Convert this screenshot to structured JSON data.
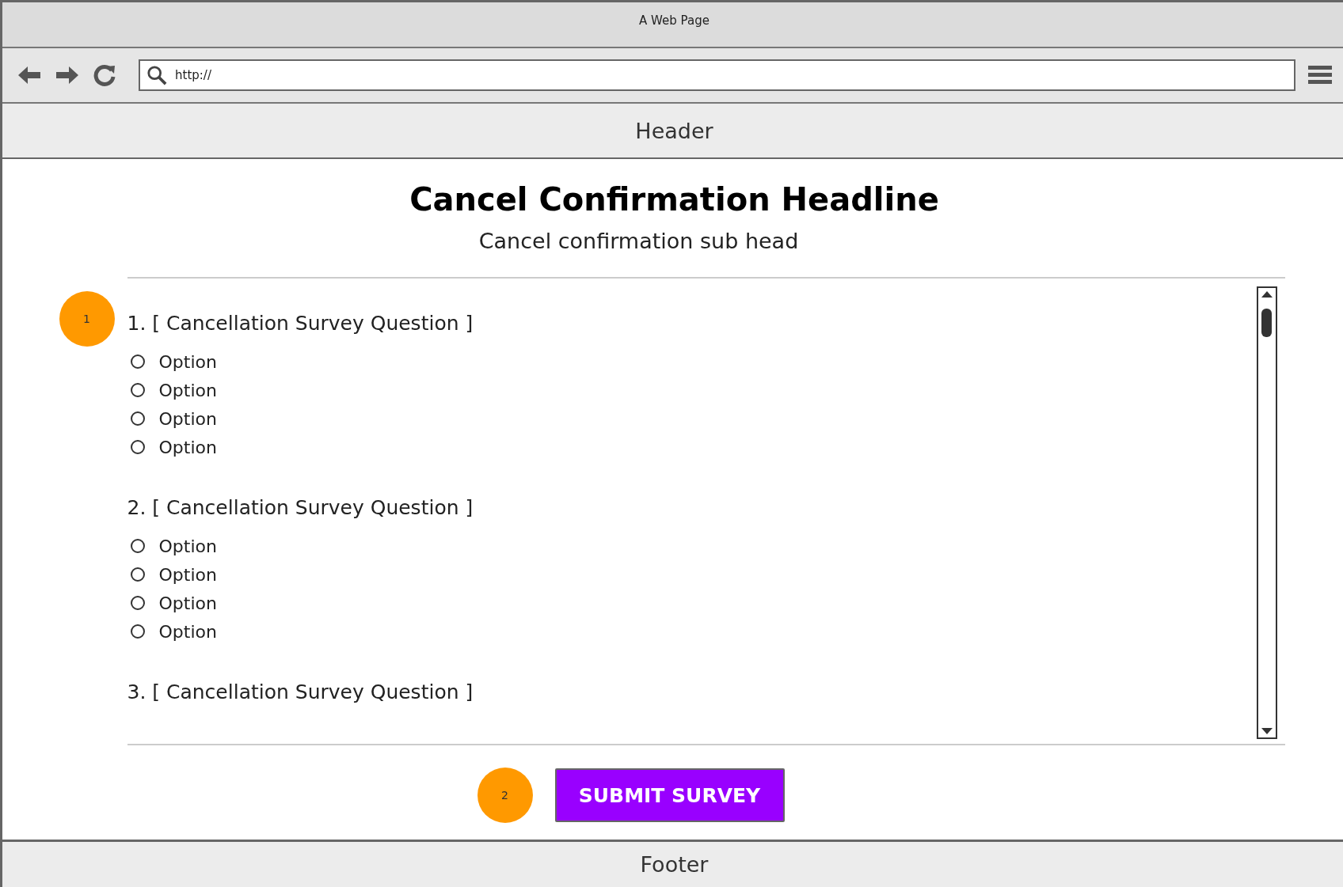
{
  "window": {
    "title": "A Web Page"
  },
  "address_bar": {
    "value": "http://"
  },
  "header": "Header",
  "headline": "Cancel Confirmation Headline",
  "subhead": "Cancel confirmation sub head",
  "questions": [
    {
      "number": "1.",
      "text": "[ Cancellation Survey Question ]",
      "options": [
        {
          "label": "Option",
          "selected": false
        },
        {
          "label": "Option",
          "selected": false
        },
        {
          "label": "Option",
          "selected": false
        },
        {
          "label": "Option",
          "selected": false
        }
      ]
    },
    {
      "number": "2.",
      "text": "[ Cancellation Survey Question ]",
      "options": [
        {
          "label": "Option",
          "selected": false
        },
        {
          "label": "Option",
          "selected": false
        },
        {
          "label": "Option",
          "selected": false
        },
        {
          "label": "Option",
          "selected": false
        }
      ]
    },
    {
      "number": "3.",
      "text": "[ Cancellation Survey Question ]"
    }
  ],
  "annotations": [
    "1",
    "2"
  ],
  "submit_button": "SUBMIT SURVEY",
  "footer": "Footer"
}
